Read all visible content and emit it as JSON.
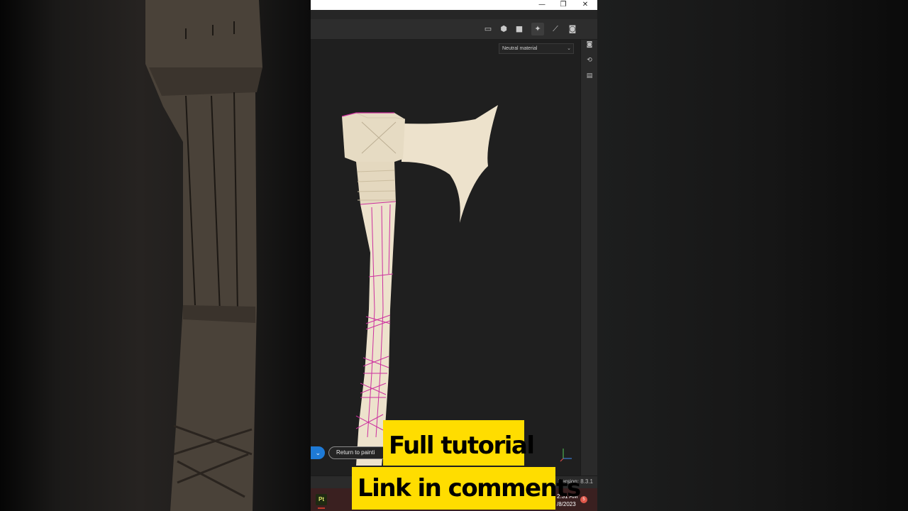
{
  "window": {
    "controls": {
      "minimize": "—",
      "restore": "❐",
      "close": "✕"
    }
  },
  "toolbar": {
    "icons": [
      "selection-icon",
      "cube-icon",
      "camera-icon",
      "paint-effect-icon",
      "brush-icon",
      "screenshot-icon"
    ]
  },
  "viewport": {
    "material_select": "Neutral material",
    "return_button": "Return to painti",
    "toggle_symbol": "⌄"
  },
  "right_panel": {
    "icons": [
      "display-settings-icon",
      "history-icon",
      "log-icon"
    ]
  },
  "status_bar": {
    "version": "Version: 8.3.1"
  },
  "taskbar": {
    "app_label": "Pt",
    "time": "2:31 AM",
    "date": "/8/2023",
    "notification_count": "5"
  },
  "captions": {
    "line1": "Full tutorial",
    "line2": "Link in comments"
  },
  "colors": {
    "model": "#ede2cc",
    "seams": "#cc2f9e",
    "caption_bg": "#ffdd00",
    "toggle_blue": "#1e7ad6"
  }
}
